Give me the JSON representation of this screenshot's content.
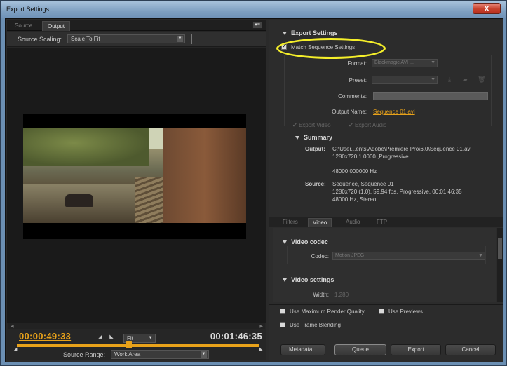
{
  "window": {
    "title": "Export Settings",
    "close_glyph": "x"
  },
  "left": {
    "tabs": [
      "Source",
      "Output"
    ],
    "panel_menu_glyph": "▾≡",
    "source_scaling_label": "Source Scaling:",
    "source_scaling_value": "Scale To Fit",
    "current_time": "00:00:49:33",
    "duration": "00:01:46:35",
    "zoom_value": "Fit",
    "source_range_label": "Source Range:",
    "source_range_value": "Work Area"
  },
  "export_settings": {
    "header": "Export Settings",
    "match_sequence": "Match Sequence Settings",
    "match_sequence_checked": true,
    "format_label": "Format:",
    "format_value": "Blackmagic AVI ...",
    "preset_label": "Preset:",
    "preset_value": "",
    "comments_label": "Comments:",
    "output_name_label": "Output Name:",
    "output_name_value": "Sequence 01.avi",
    "export_video": "Export Video",
    "export_audio": "Export Audio"
  },
  "summary": {
    "header": "Summary",
    "output_label": "Output:",
    "output_line1": "C:\\User...ents\\Adobe\\Premiere Pro\\6.0\\Sequence 01.avi",
    "output_line2": "1280x720 1.0000 ,Progressive",
    "output_line3": "48000.000000 Hz",
    "source_label": "Source:",
    "source_line1": "Sequence, Sequence 01",
    "source_line2": "1280x720 (1.0), 59.94 fps, Progressive, 00:01:46:35",
    "source_line3": "48000 Hz, Stereo"
  },
  "subtabs": [
    "Filters",
    "Video",
    "Audio",
    "FTP"
  ],
  "video_panel": {
    "codec_header": "Video codec",
    "codec_label": "Codec:",
    "codec_value": "Motion JPEG",
    "settings_header": "Video settings",
    "width_label": "Width:",
    "width_value": "1,280"
  },
  "options": {
    "max_render_quality": "Use Maximum Render Quality",
    "use_previews": "Use Previews",
    "frame_blending": "Use Frame Blending"
  },
  "buttons": {
    "metadata": "Metadata...",
    "queue": "Queue",
    "export": "Export",
    "cancel": "Cancel"
  },
  "accent_color": "#e8a21a",
  "highlight_color": "#f5ef2a"
}
